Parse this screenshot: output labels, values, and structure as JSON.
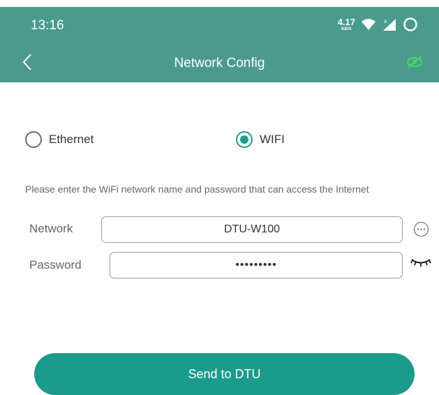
{
  "status_bar": {
    "time": "13:16",
    "net_speed_value": "4.17",
    "net_speed_unit": "KB/S",
    "icons": [
      "wifi-icon",
      "signal-icon",
      "battery-icon"
    ]
  },
  "nav": {
    "title": "Network Config",
    "back_icon": "chevron-left-icon",
    "action_icon": "eye-icon"
  },
  "connection_type": {
    "options": [
      {
        "label": "Ethernet",
        "selected": false
      },
      {
        "label": "WIFI",
        "selected": true
      }
    ]
  },
  "hint_text": "Please enter the WiFi network name and password that can access the Internet",
  "form": {
    "network_label": "Network",
    "network_value": "DTU-W100",
    "password_label": "Password",
    "password_value": "•••••••••"
  },
  "send_button_label": "Send to DTU",
  "colors": {
    "header_bg": "#4a9b8e",
    "accent": "#1a9b8b",
    "radio_selected": "#1e9c86",
    "nav_action_icon": "#4cd964"
  }
}
